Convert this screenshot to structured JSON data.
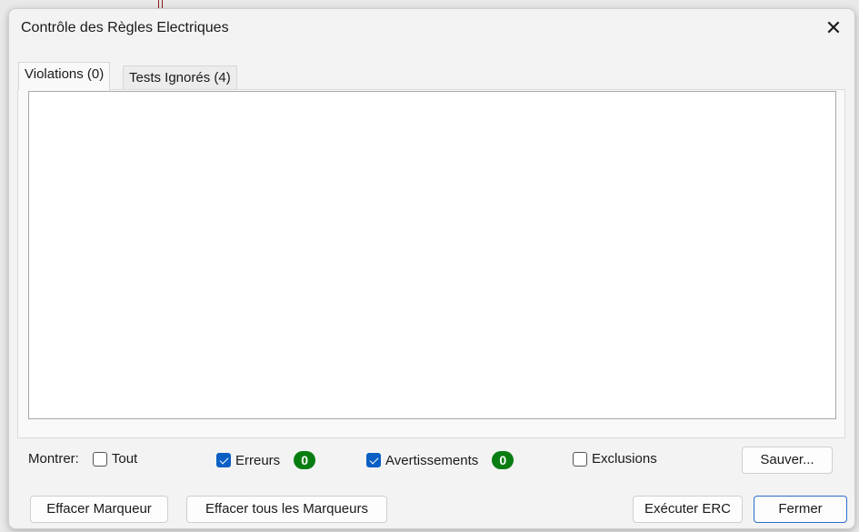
{
  "dialog": {
    "title": "Contrôle des Règles Electriques"
  },
  "tabs": [
    {
      "label": "Violations (0)",
      "active": true
    },
    {
      "label": "Tests Ignorés (4)",
      "active": false
    }
  ],
  "filters": {
    "label": "Montrer:",
    "all": {
      "label": "Tout",
      "checked": false
    },
    "errors": {
      "label": "Erreurs",
      "checked": true,
      "count": "0"
    },
    "warnings": {
      "label": "Avertissements",
      "checked": true,
      "count": "0"
    },
    "exclusions": {
      "label": "Exclusions",
      "checked": false
    }
  },
  "buttons": {
    "save": "Sauver...",
    "clear_marker": "Effacer Marqueur",
    "clear_all": "Effacer tous les Marqueurs",
    "run": "Exécuter ERC",
    "close": "Fermer"
  },
  "colors": {
    "badge": "#0a7d12",
    "accent": "#0a5fc4"
  },
  "icons": {
    "close": "close-icon"
  }
}
